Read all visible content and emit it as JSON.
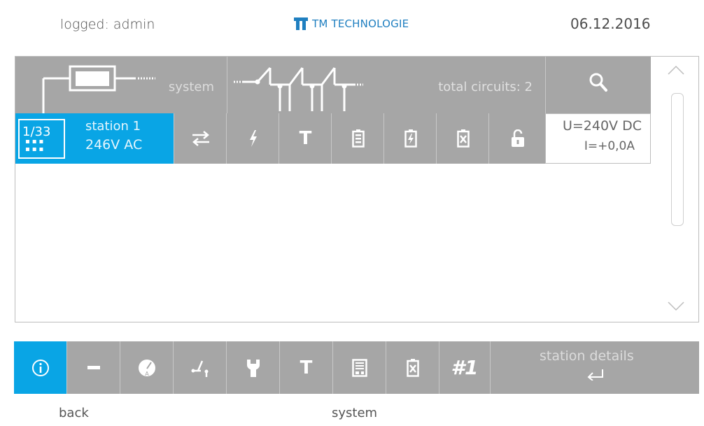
{
  "header": {
    "user": "logged: admin",
    "logo_text": "TM TECHNOLOGIE",
    "date": "06.12.2016",
    "brand_color": "#1f7fc0"
  },
  "top_bar": {
    "system_label": "system",
    "circuits_label": "total circuits: 2",
    "search_icon": "search-icon"
  },
  "station_row": {
    "badge": "1/33",
    "name": "station 1",
    "voltage": "246V AC",
    "icons": [
      "transfer-icon",
      "lightning-icon",
      "temperature-icon",
      "battery-icon",
      "battery-charge-icon",
      "battery-fault-icon",
      "unlock-icon"
    ],
    "t_label": "T",
    "u_value": "U=240V DC",
    "i_value": "I=+0,0A",
    "accent": "#09a5e5"
  },
  "bottom_bar": {
    "items": [
      "info-icon",
      "minus-icon",
      "ammeter-icon",
      "switch-icon",
      "wrench-icon",
      "temperature-icon",
      "storage-icon",
      "battery-fault-icon",
      "station-number"
    ],
    "t_label": "T",
    "hash_label": "#1",
    "details_label": "station details"
  },
  "footer": {
    "back": "back",
    "system": "system"
  }
}
